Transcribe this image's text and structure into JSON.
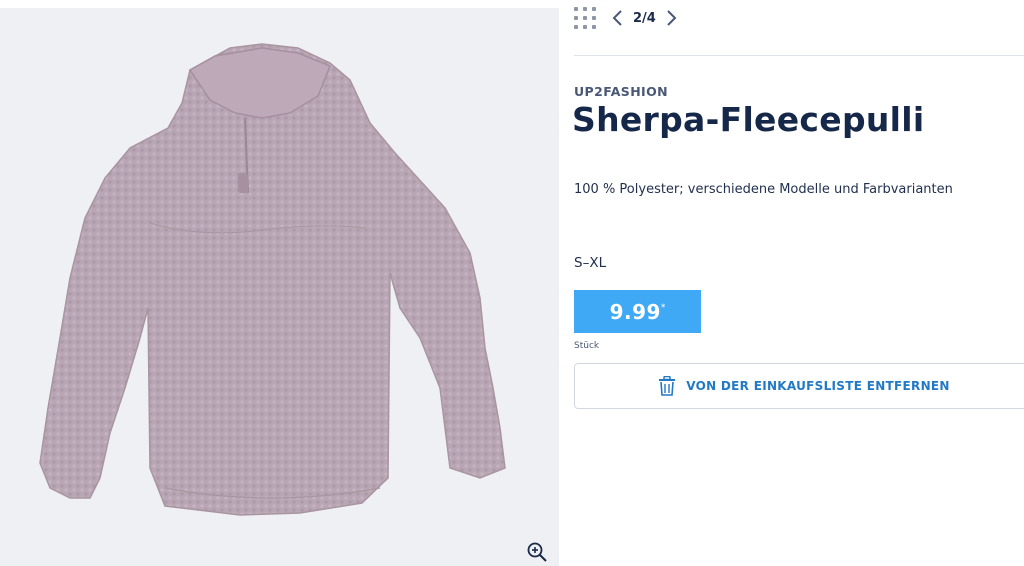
{
  "gallery": {
    "image_alt": "Sherpa-Fleecepulli",
    "zoom_icon": "zoom-in-icon",
    "background_color": "#eef0f3",
    "product_color": "#b9a6b5"
  },
  "nav": {
    "grid_icon": "grid-icon",
    "prev_icon": "chevron-left-icon",
    "next_icon": "chevron-right-icon",
    "pager": "2/4"
  },
  "product": {
    "brand": "UP2FASHION",
    "title": "Sherpa-Fleecepulli",
    "description": "100 % Polyester;  verschiedene Modelle und Farbvarianten",
    "sizes": "S–XL",
    "price": "9.99",
    "price_mark": "*",
    "unit": "Stück",
    "price_color": "#3fa9f5"
  },
  "actions": {
    "remove_icon": "trash-icon",
    "remove_label": "VON DER EINKAUFSLISTE ENTFERNEN",
    "accent_color": "#2279c5"
  }
}
